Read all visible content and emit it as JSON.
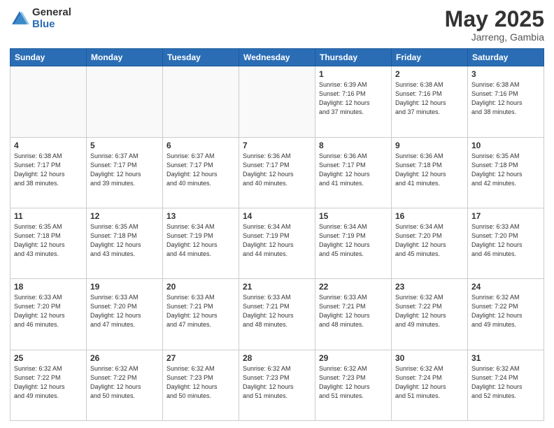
{
  "header": {
    "logo_general": "General",
    "logo_blue": "Blue",
    "title": "May 2025",
    "location": "Jarreng, Gambia"
  },
  "days_of_week": [
    "Sunday",
    "Monday",
    "Tuesday",
    "Wednesday",
    "Thursday",
    "Friday",
    "Saturday"
  ],
  "weeks": [
    [
      {
        "num": "",
        "info": ""
      },
      {
        "num": "",
        "info": ""
      },
      {
        "num": "",
        "info": ""
      },
      {
        "num": "",
        "info": ""
      },
      {
        "num": "1",
        "info": "Sunrise: 6:39 AM\nSunset: 7:16 PM\nDaylight: 12 hours\nand 37 minutes."
      },
      {
        "num": "2",
        "info": "Sunrise: 6:38 AM\nSunset: 7:16 PM\nDaylight: 12 hours\nand 37 minutes."
      },
      {
        "num": "3",
        "info": "Sunrise: 6:38 AM\nSunset: 7:16 PM\nDaylight: 12 hours\nand 38 minutes."
      }
    ],
    [
      {
        "num": "4",
        "info": "Sunrise: 6:38 AM\nSunset: 7:17 PM\nDaylight: 12 hours\nand 38 minutes."
      },
      {
        "num": "5",
        "info": "Sunrise: 6:37 AM\nSunset: 7:17 PM\nDaylight: 12 hours\nand 39 minutes."
      },
      {
        "num": "6",
        "info": "Sunrise: 6:37 AM\nSunset: 7:17 PM\nDaylight: 12 hours\nand 40 minutes."
      },
      {
        "num": "7",
        "info": "Sunrise: 6:36 AM\nSunset: 7:17 PM\nDaylight: 12 hours\nand 40 minutes."
      },
      {
        "num": "8",
        "info": "Sunrise: 6:36 AM\nSunset: 7:17 PM\nDaylight: 12 hours\nand 41 minutes."
      },
      {
        "num": "9",
        "info": "Sunrise: 6:36 AM\nSunset: 7:18 PM\nDaylight: 12 hours\nand 41 minutes."
      },
      {
        "num": "10",
        "info": "Sunrise: 6:35 AM\nSunset: 7:18 PM\nDaylight: 12 hours\nand 42 minutes."
      }
    ],
    [
      {
        "num": "11",
        "info": "Sunrise: 6:35 AM\nSunset: 7:18 PM\nDaylight: 12 hours\nand 43 minutes."
      },
      {
        "num": "12",
        "info": "Sunrise: 6:35 AM\nSunset: 7:18 PM\nDaylight: 12 hours\nand 43 minutes."
      },
      {
        "num": "13",
        "info": "Sunrise: 6:34 AM\nSunset: 7:19 PM\nDaylight: 12 hours\nand 44 minutes."
      },
      {
        "num": "14",
        "info": "Sunrise: 6:34 AM\nSunset: 7:19 PM\nDaylight: 12 hours\nand 44 minutes."
      },
      {
        "num": "15",
        "info": "Sunrise: 6:34 AM\nSunset: 7:19 PM\nDaylight: 12 hours\nand 45 minutes."
      },
      {
        "num": "16",
        "info": "Sunrise: 6:34 AM\nSunset: 7:20 PM\nDaylight: 12 hours\nand 45 minutes."
      },
      {
        "num": "17",
        "info": "Sunrise: 6:33 AM\nSunset: 7:20 PM\nDaylight: 12 hours\nand 46 minutes."
      }
    ],
    [
      {
        "num": "18",
        "info": "Sunrise: 6:33 AM\nSunset: 7:20 PM\nDaylight: 12 hours\nand 46 minutes."
      },
      {
        "num": "19",
        "info": "Sunrise: 6:33 AM\nSunset: 7:20 PM\nDaylight: 12 hours\nand 47 minutes."
      },
      {
        "num": "20",
        "info": "Sunrise: 6:33 AM\nSunset: 7:21 PM\nDaylight: 12 hours\nand 47 minutes."
      },
      {
        "num": "21",
        "info": "Sunrise: 6:33 AM\nSunset: 7:21 PM\nDaylight: 12 hours\nand 48 minutes."
      },
      {
        "num": "22",
        "info": "Sunrise: 6:33 AM\nSunset: 7:21 PM\nDaylight: 12 hours\nand 48 minutes."
      },
      {
        "num": "23",
        "info": "Sunrise: 6:32 AM\nSunset: 7:22 PM\nDaylight: 12 hours\nand 49 minutes."
      },
      {
        "num": "24",
        "info": "Sunrise: 6:32 AM\nSunset: 7:22 PM\nDaylight: 12 hours\nand 49 minutes."
      }
    ],
    [
      {
        "num": "25",
        "info": "Sunrise: 6:32 AM\nSunset: 7:22 PM\nDaylight: 12 hours\nand 49 minutes."
      },
      {
        "num": "26",
        "info": "Sunrise: 6:32 AM\nSunset: 7:22 PM\nDaylight: 12 hours\nand 50 minutes."
      },
      {
        "num": "27",
        "info": "Sunrise: 6:32 AM\nSunset: 7:23 PM\nDaylight: 12 hours\nand 50 minutes."
      },
      {
        "num": "28",
        "info": "Sunrise: 6:32 AM\nSunset: 7:23 PM\nDaylight: 12 hours\nand 51 minutes."
      },
      {
        "num": "29",
        "info": "Sunrise: 6:32 AM\nSunset: 7:23 PM\nDaylight: 12 hours\nand 51 minutes."
      },
      {
        "num": "30",
        "info": "Sunrise: 6:32 AM\nSunset: 7:24 PM\nDaylight: 12 hours\nand 51 minutes."
      },
      {
        "num": "31",
        "info": "Sunrise: 6:32 AM\nSunset: 7:24 PM\nDaylight: 12 hours\nand 52 minutes."
      }
    ]
  ]
}
